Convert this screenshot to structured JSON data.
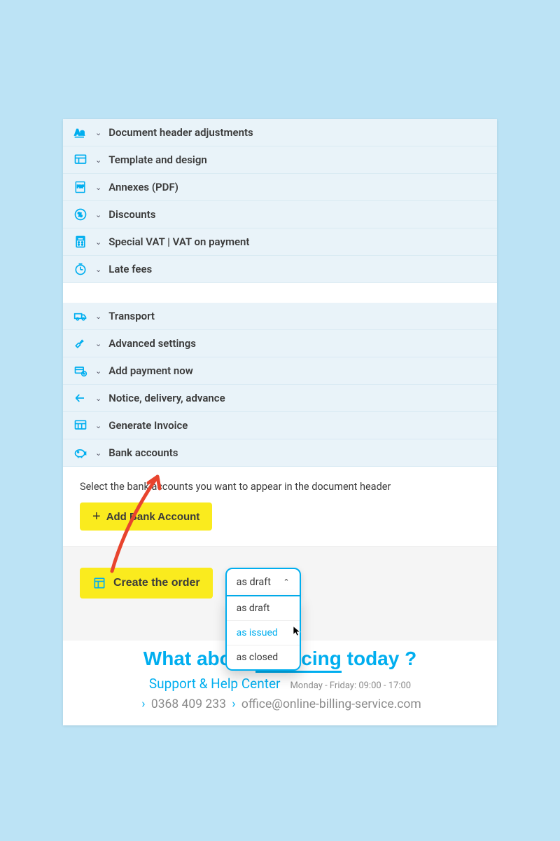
{
  "accordion_group1": [
    {
      "icon": "font-icon",
      "label": "Document header adjustments"
    },
    {
      "icon": "template-icon",
      "label": "Template and design"
    },
    {
      "icon": "pdf-icon",
      "label": "Annexes (PDF)"
    },
    {
      "icon": "discount-icon",
      "label": "Discounts"
    },
    {
      "icon": "calculator-icon",
      "label": "Special VAT | VAT on payment"
    },
    {
      "icon": "clock-icon",
      "label": "Late fees"
    }
  ],
  "accordion_group2": [
    {
      "icon": "truck-icon",
      "label": "Transport"
    },
    {
      "icon": "wrench-icon",
      "label": "Advanced settings"
    },
    {
      "icon": "payment-icon",
      "label": "Add payment now"
    },
    {
      "icon": "delivery-icon",
      "label": "Notice, delivery, advance"
    },
    {
      "icon": "invoice-icon",
      "label": "Generate Invoice"
    },
    {
      "icon": "piggy-icon",
      "label": "Bank accounts"
    }
  ],
  "bank_section": {
    "help_text": "Select the bank accounts you want to appear in the document header",
    "add_button_label": "Add Bank Account"
  },
  "create_button_label": "Create the order",
  "dropdown": {
    "selected": "as draft",
    "options": [
      {
        "label": "as draft",
        "highlighted": false
      },
      {
        "label": "as issued",
        "highlighted": true
      },
      {
        "label": "as closed",
        "highlighted": false
      }
    ]
  },
  "footer": {
    "headline_prefix": "What about ",
    "headline_underline": "invoicing",
    "headline_suffix": " today ?",
    "support_label": "Support & Help Center",
    "hours": "Monday - Friday: 09:00 - 17:00",
    "phone": "0368 409 233",
    "email": "office@online-billing-service.com"
  }
}
